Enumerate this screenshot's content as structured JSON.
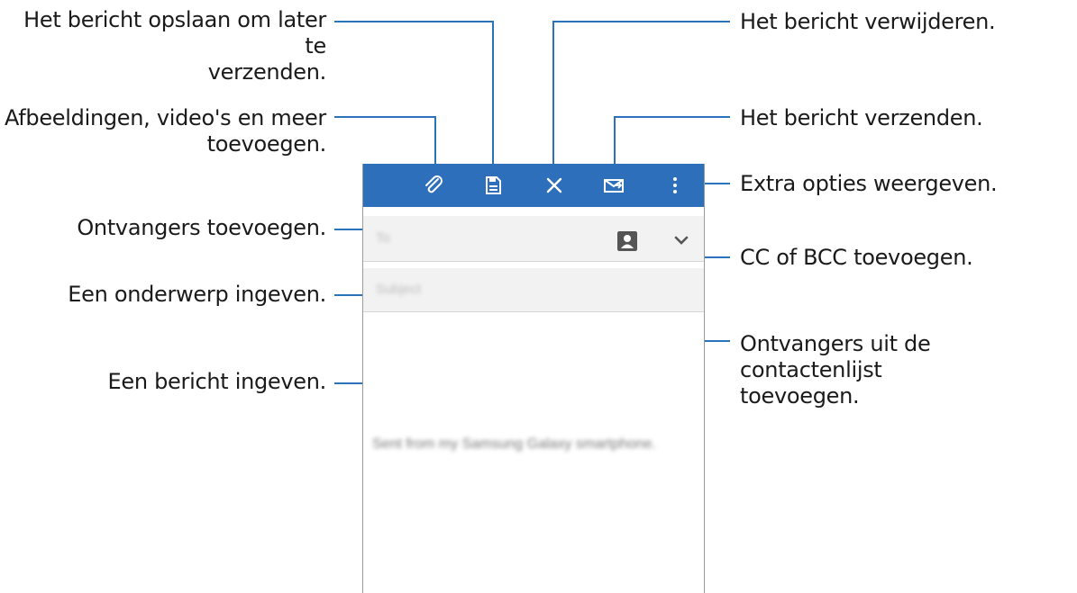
{
  "annotations": {
    "save": "Het bericht opslaan om later te\nverzenden.",
    "attach": "Afbeeldingen, video's en meer\ntoevoegen.",
    "recipients": "Ontvangers toevoegen.",
    "subject": "Een onderwerp ingeven.",
    "message": "Een bericht ingeven.",
    "delete": "Het bericht verwijderen.",
    "send": "Het bericht verzenden.",
    "options": "Extra opties weergeven.",
    "ccbcc": "CC of BCC toevoegen.",
    "contacts": "Ontvangers uit de contactenlijst\ntoevoegen."
  },
  "compose": {
    "to_placeholder": "To",
    "subject_placeholder": "Subject",
    "body_text": "Sent from my Samsung Galaxy smartphone."
  },
  "icons": {
    "attach": "paperclip-icon",
    "save": "save-icon",
    "delete": "close-icon",
    "send": "send-icon",
    "more": "more-options-icon",
    "contacts": "contact-icon",
    "expand": "chevron-down-icon"
  },
  "colors": {
    "toolbar": "#2e6fbc",
    "leader_lines": "#2a73bb"
  }
}
